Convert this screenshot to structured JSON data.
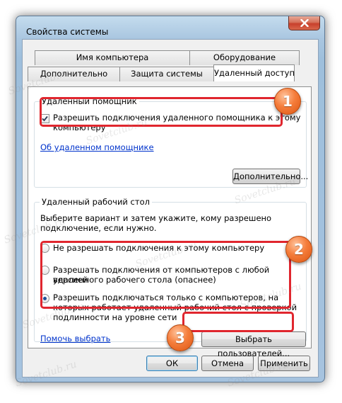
{
  "window": {
    "title": "Свойства системы"
  },
  "tabs": {
    "row1": [
      "Имя компьютера",
      "Оборудование"
    ],
    "row2": [
      "Дополнительно",
      "Защита системы",
      "Удаленный доступ"
    ],
    "active": "Удаленный доступ"
  },
  "remote_assistance": {
    "group_title": "Удаленный помощник",
    "checkbox_label_line1": "Разрешить подключения удаленного помощника к этому",
    "checkbox_label_line2": "компьютеру",
    "checkbox_checked": true,
    "help_link": "Об удаленном помощнике",
    "advanced_button": "Дополнительно..."
  },
  "remote_desktop": {
    "group_title": "Удаленный рабочий стол",
    "instructions_line1": "Выберите вариант и затем укажите, кому разрешено",
    "instructions_line2": "подключение, если нужно.",
    "option_none": "Не разрешать подключения к этому компьютеру",
    "option_any_line1": "Разрешать подключения от компьютеров с любой версией",
    "option_any_line2": "удаленного рабочего стола (опаснее)",
    "option_nla_line1": "Разрешить подключаться только с компьютеров, на",
    "option_nla_line2": "которых работает удаленный рабочий стол с проверкой",
    "option_nla_line3": "подлинности на уровне сети",
    "selected_option": "option_nla",
    "help_link": "Помочь выбрать",
    "select_users_button": "Выбрать пользователей..."
  },
  "footer": {
    "ok": "ОК",
    "cancel": "Отмена",
    "apply": "Применить"
  },
  "markers": [
    "1",
    "2",
    "3"
  ],
  "watermark": "Sovetclub.ru",
  "colors": {
    "highlight": "#e0262e",
    "marker": "#f57d3b",
    "link": "#0033cc"
  }
}
